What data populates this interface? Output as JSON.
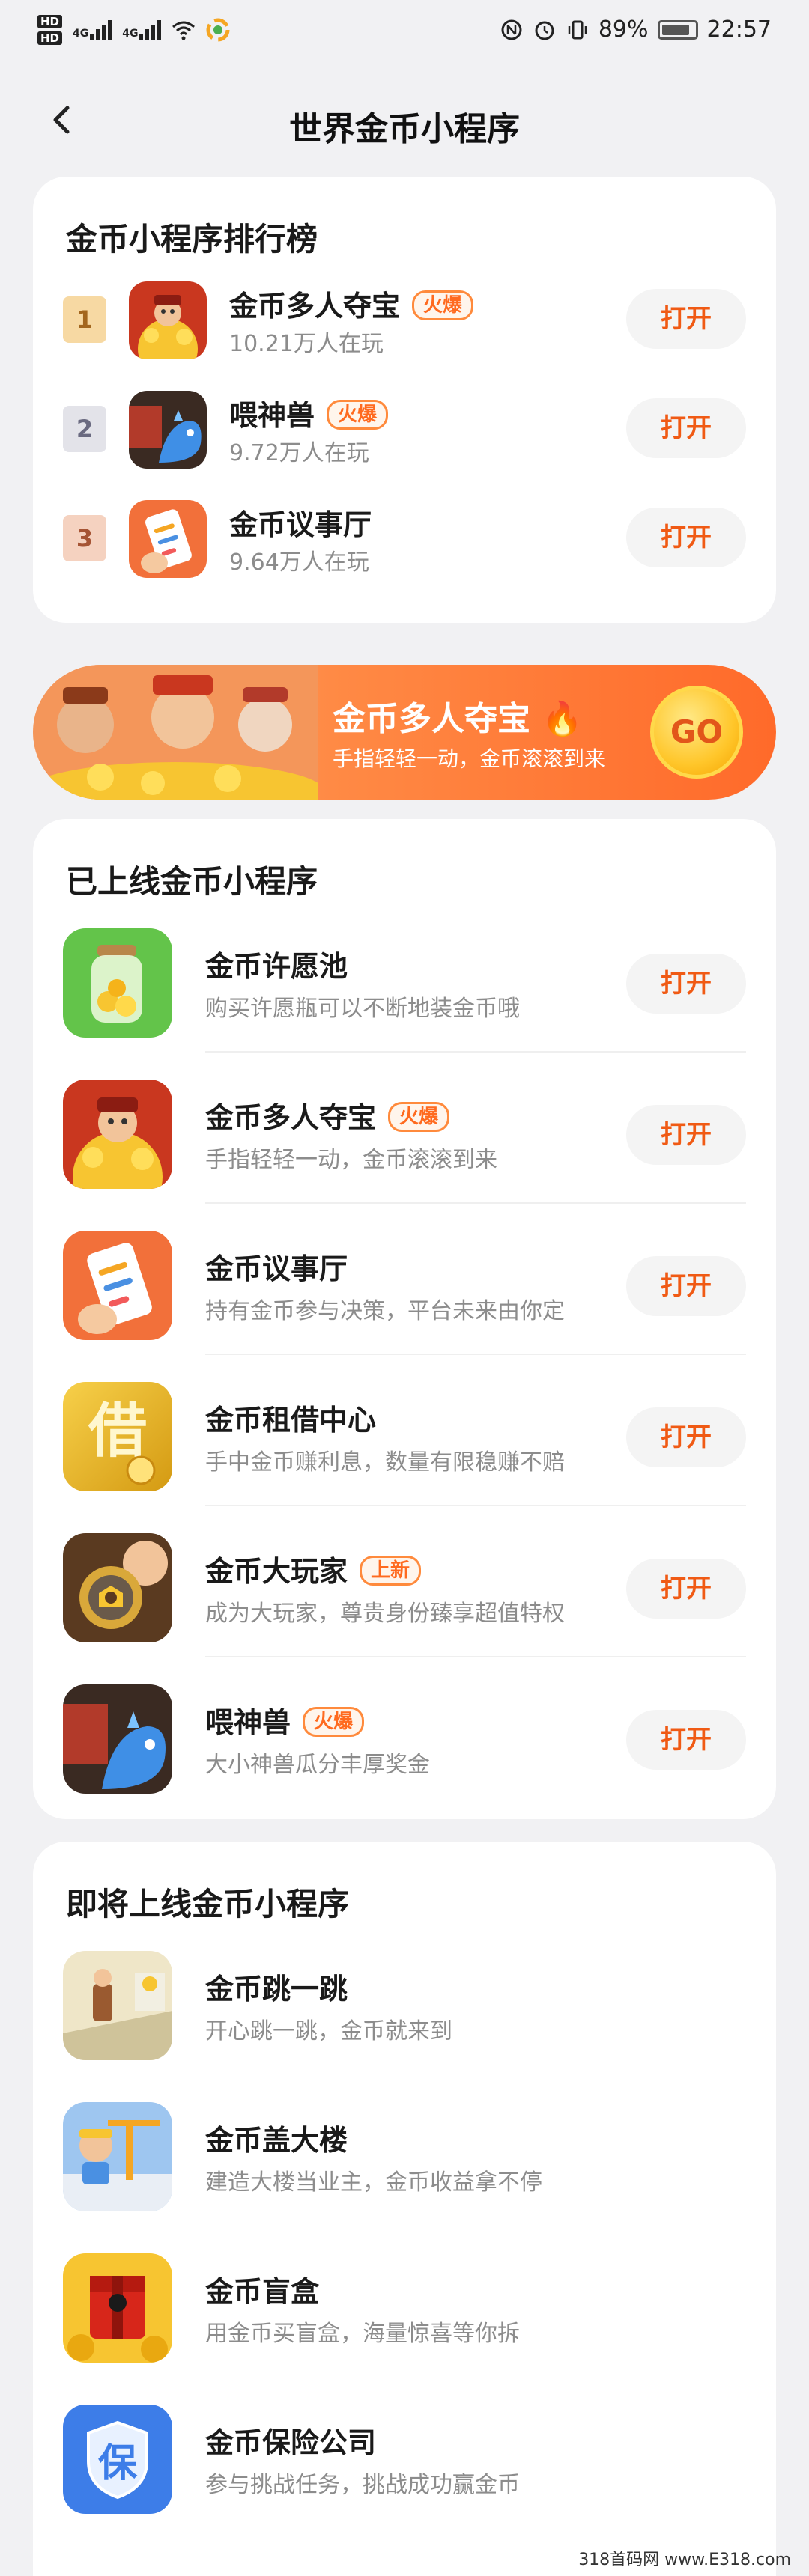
{
  "status_bar": {
    "hd1": "HD",
    "hd2": "HD",
    "net1": "4G",
    "net2": "4G",
    "battery_pct": "89%",
    "time": "22:57"
  },
  "nav": {
    "title": "世界金币小程序",
    "back_icon": "chevron-left-icon"
  },
  "ranking": {
    "title": "金币小程序排行榜",
    "items": [
      {
        "rank": "1",
        "name": "金币多人夺宝",
        "tag": "火爆",
        "sub": "10.21万人在玩",
        "button": "打开"
      },
      {
        "rank": "2",
        "name": "喂神兽",
        "tag": "火爆",
        "sub": "9.72万人在玩",
        "button": "打开"
      },
      {
        "rank": "3",
        "name": "金币议事厅",
        "tag": "",
        "sub": "9.64万人在玩",
        "button": "打开"
      }
    ]
  },
  "banner": {
    "title": "金币多人夺宝",
    "sub": "手指轻轻一动，金币滚滚到来",
    "go": "GO"
  },
  "online": {
    "title": "已上线金币小程序",
    "items": [
      {
        "name": "金币许愿池",
        "tag": "",
        "sub": "购买许愿瓶可以不断地装金币哦",
        "button": "打开"
      },
      {
        "name": "金币多人夺宝",
        "tag": "火爆",
        "sub": "手指轻轻一动，金币滚滚到来",
        "button": "打开"
      },
      {
        "name": "金币议事厅",
        "tag": "",
        "sub": "持有金币参与决策，平台未来由你定",
        "button": "打开"
      },
      {
        "name": "金币租借中心",
        "tag": "",
        "sub": "手中金币赚利息，数量有限稳赚不赔",
        "button": "打开"
      },
      {
        "name": "金币大玩家",
        "tag": "上新",
        "sub": "成为大玩家，尊贵身份臻享超值特权",
        "button": "打开"
      },
      {
        "name": "喂神兽",
        "tag": "火爆",
        "sub": "大小神兽瓜分丰厚奖金",
        "button": "打开"
      }
    ]
  },
  "upcoming": {
    "title": "即将上线金币小程序",
    "items": [
      {
        "name": "金币跳一跳",
        "sub": "开心跳一跳，金币就来到"
      },
      {
        "name": "金币盖大楼",
        "sub": "建造大楼当业主，金币收益拿不停"
      },
      {
        "name": "金币盲盒",
        "sub": "用金币买盲盒，海量惊喜等你拆"
      },
      {
        "name": "金币保险公司",
        "sub": "参与挑战任务，挑战成功赢金币"
      }
    ]
  },
  "icons": {
    "jiebi_char": "借",
    "bao_char": "保"
  },
  "watermark": "318首码网 www.E318.com",
  "colors": {
    "accent": "#f05a14",
    "tag": "#ff6a1f",
    "card_bg": "#ffffff",
    "page_bg": "#f1f1f3"
  }
}
